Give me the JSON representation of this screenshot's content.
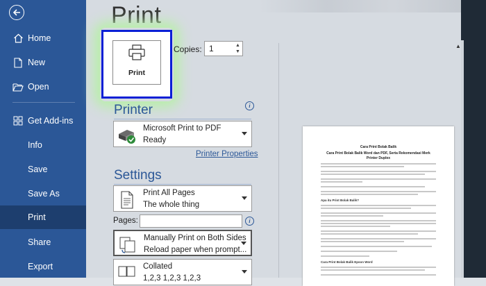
{
  "sidebar": {
    "items": [
      {
        "label": "Home",
        "icon": "home-icon"
      },
      {
        "label": "New",
        "icon": "new-document-icon"
      },
      {
        "label": "Open",
        "icon": "folder-open-icon"
      },
      {
        "label": "Get Add-ins",
        "icon": "add-ins-grid-icon"
      },
      {
        "label": "Info",
        "icon": ""
      },
      {
        "label": "Save",
        "icon": ""
      },
      {
        "label": "Save As",
        "icon": ""
      },
      {
        "label": "Print",
        "icon": "",
        "active": true
      },
      {
        "label": "Share",
        "icon": ""
      },
      {
        "label": "Export",
        "icon": ""
      }
    ]
  },
  "page": {
    "title": "Print"
  },
  "print_button": {
    "label": "Print"
  },
  "copies": {
    "label": "Copies:",
    "value": "1"
  },
  "printer": {
    "heading": "Printer",
    "name": "Microsoft Print to PDF",
    "status": "Ready",
    "properties_link": "Printer Properties"
  },
  "settings": {
    "heading": "Settings",
    "print_range": {
      "line1": "Print All Pages",
      "line2": "The whole thing"
    },
    "pages_label": "Pages:",
    "sides": {
      "line1": "Manually Print on Both Sides",
      "line2": "Reload paper when prompt..."
    },
    "collation": {
      "line1": "Collated",
      "line2": "1,2,3    1,2,3    1,2,3"
    }
  },
  "preview": {
    "title": "Cara Print Bolak Balik",
    "subtitle1": "Cara Print Bolak Balik Word dan PDF, Serta Rekomendasi Merk",
    "subtitle2": "Printer Duplex",
    "heading1": "Apa itu Print Bolak Balik?",
    "heading2": "Cara Print Bolak Balik Epson Word"
  },
  "colors": {
    "sidebar": "#2b5797",
    "accent": "#2b5797",
    "highlight_border": "#0a1fd6"
  }
}
